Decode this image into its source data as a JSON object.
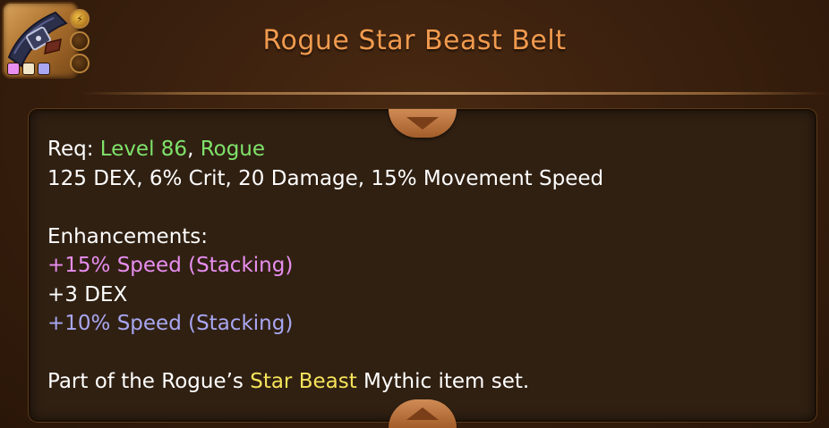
{
  "item": {
    "title": "Rogue Star Beast Belt",
    "gem_colors": [
      "#e88ef0",
      "#f2e6c8",
      "#a9a7f2"
    ],
    "socket_symbol": "⚡",
    "icon": "belt-icon"
  },
  "requirements": {
    "label": "Req: ",
    "level": "Level 86",
    "separator": ", ",
    "class": "Rogue"
  },
  "stats": "125 DEX, 6% Crit, 20 Damage, 15% Movement Speed",
  "enhancements": {
    "header": "Enhancements:",
    "items": [
      {
        "text": "+15% Speed (Stacking)",
        "color": "#e88ef0"
      },
      {
        "text": "+3 DEX",
        "color": "#ffffff"
      },
      {
        "text": "+10% Speed (Stacking)",
        "color": "#a9a7f2"
      }
    ]
  },
  "set_info": {
    "prefix": "Part of the Rogue’s ",
    "set_name": "Star Beast",
    "suffix": " Mythic item set."
  },
  "colors": {
    "title": "#f19a4e",
    "requirement_highlight": "#7fe36a",
    "set_name": "#f6e45a"
  }
}
